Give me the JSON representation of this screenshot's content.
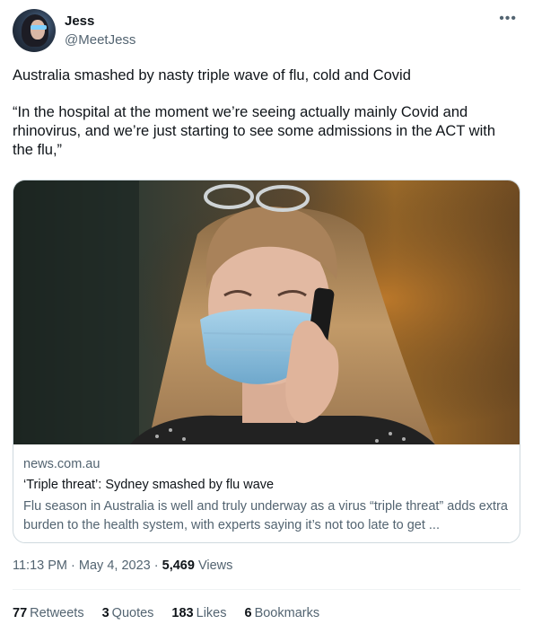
{
  "user": {
    "name": "Jess",
    "handle": "@MeetJess"
  },
  "tweet": {
    "paragraphs": [
      "Australia smashed by nasty triple wave of flu, cold and Covid",
      "“In the hospital at the moment we’re seeing actually mainly Covid and rhinovirus, and we’re just starting to see some admissions in the ACT with the flu,”"
    ]
  },
  "card": {
    "domain": "news.com.au",
    "title": "‘Triple threat’: Sydney smashed by flu wave",
    "description": "Flu season in Australia is well and truly underway as a virus “triple threat” adds extra burden to the health system, with experts saying it’s not too late to get ..."
  },
  "meta": {
    "time": "11:13 PM",
    "separator": "·",
    "date": "May 4, 2023",
    "views_count": "5,469",
    "views_label": "Views"
  },
  "stats": {
    "retweets": {
      "count": "77",
      "label": "Retweets"
    },
    "quotes": {
      "count": "3",
      "label": "Quotes"
    },
    "likes": {
      "count": "183",
      "label": "Likes"
    },
    "bookmarks": {
      "count": "6",
      "label": "Bookmarks"
    }
  },
  "icons": {
    "more": "more-options-icon"
  }
}
